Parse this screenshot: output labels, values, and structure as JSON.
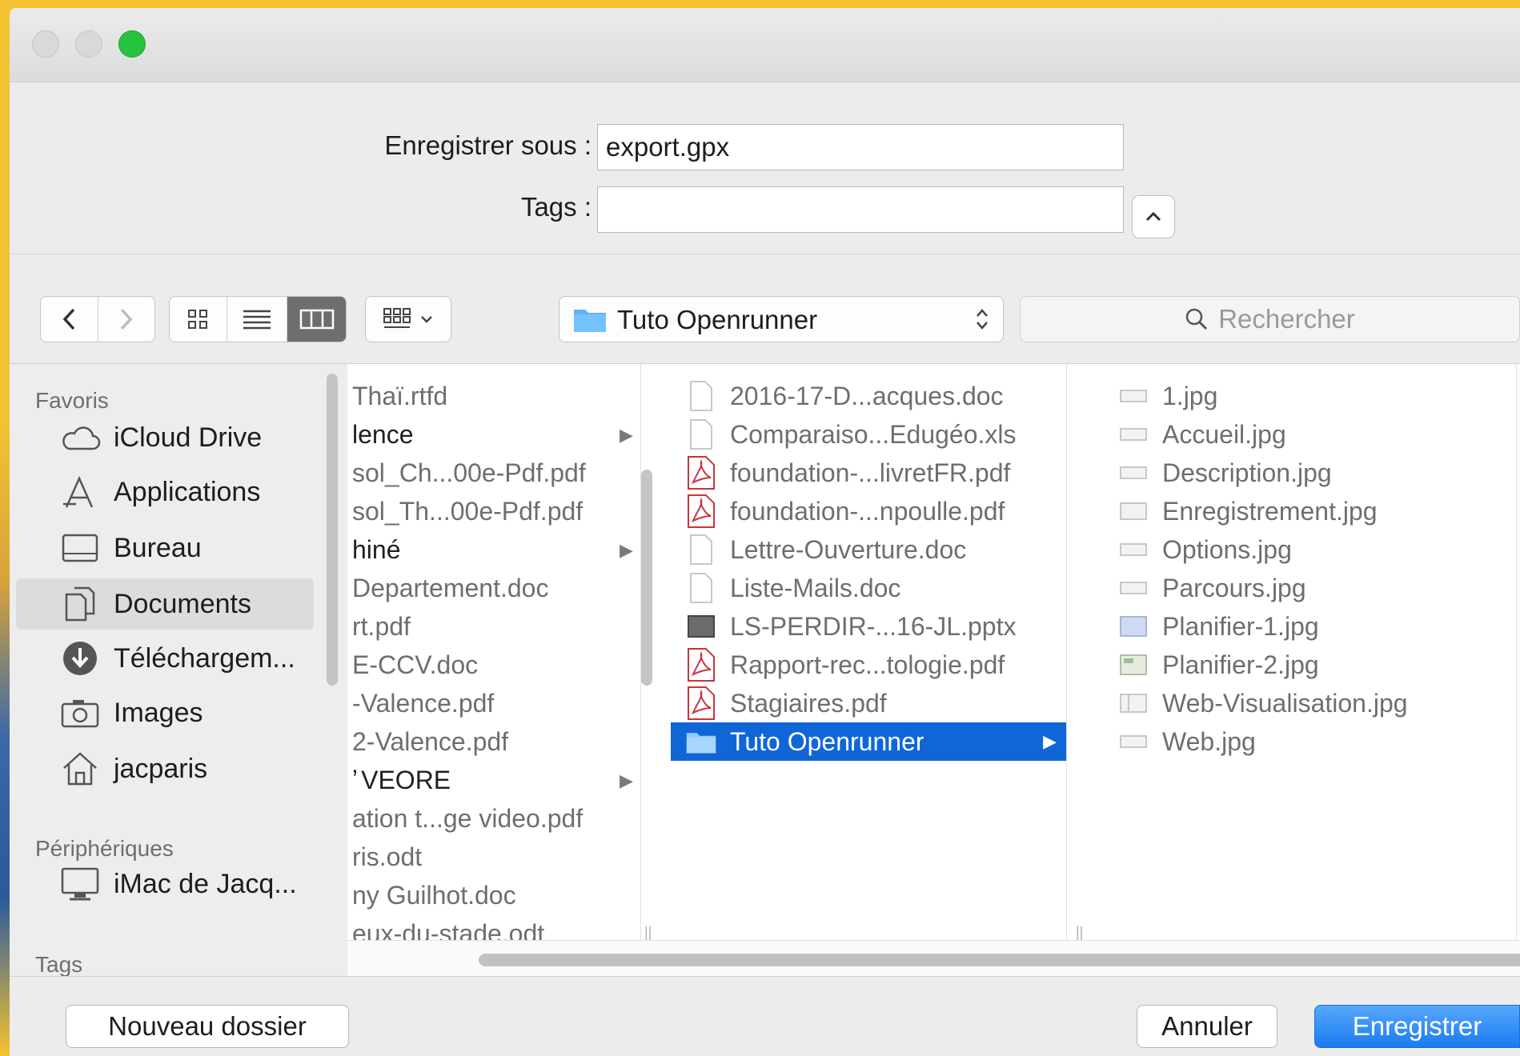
{
  "dialog": {
    "save_as_label": "Enregistrer sous :",
    "save_as_value": "export.gpx",
    "tags_label": "Tags :",
    "tags_value": ""
  },
  "toolbar": {
    "location": "Tuto Openrunner",
    "search_placeholder": "Rechercher",
    "active_view": "columns"
  },
  "sidebar": {
    "favorites_header": "Favoris",
    "favorites": [
      {
        "label": "iCloud Drive",
        "icon": "cloud-icon"
      },
      {
        "label": "Applications",
        "icon": "applications-icon"
      },
      {
        "label": "Bureau",
        "icon": "desktop-icon"
      },
      {
        "label": "Documents",
        "icon": "documents-icon",
        "selected": true
      },
      {
        "label": "Téléchargem...",
        "icon": "download-icon"
      },
      {
        "label": "Images",
        "icon": "camera-icon"
      },
      {
        "label": "jacparis",
        "icon": "home-icon"
      }
    ],
    "devices_header": "Périphériques",
    "devices": [
      {
        "label": "iMac de Jacq...",
        "icon": "computer-icon"
      }
    ],
    "tags_header": "Tags"
  },
  "columns": {
    "col1": [
      {
        "name": "Thaï.rtfd",
        "folder": false
      },
      {
        "name": "lence",
        "folder": true
      },
      {
        "name": "sol_Ch...00e-Pdf.pdf",
        "folder": false
      },
      {
        "name": "sol_Th...00e-Pdf.pdf",
        "folder": false
      },
      {
        "name": "hiné",
        "folder": true
      },
      {
        "name": "Departement.doc",
        "folder": false
      },
      {
        "name": "rt.pdf",
        "folder": false
      },
      {
        "name": "E-CCV.doc",
        "folder": false
      },
      {
        "name": "-Valence.pdf",
        "folder": false
      },
      {
        "name": "2-Valence.pdf",
        "folder": false
      },
      {
        "name": "VEORE",
        "folder": true
      },
      {
        "name": "ation t...ge video.pdf",
        "folder": false
      },
      {
        "name": "ris.odt",
        "folder": false
      },
      {
        "name": "ny Guilhot.doc",
        "folder": false
      },
      {
        "name": "eux-du-stade.odt",
        "folder": false
      }
    ],
    "col2": [
      {
        "name": "2016-17-D...acques.doc",
        "type": "doc"
      },
      {
        "name": "Comparaiso...Edugéo.xls",
        "type": "doc"
      },
      {
        "name": "foundation-...livretFR.pdf",
        "type": "pdf"
      },
      {
        "name": "foundation-...npoulle.pdf",
        "type": "pdf"
      },
      {
        "name": "Lettre-Ouverture.doc",
        "type": "doc"
      },
      {
        "name": "Liste-Mails.doc",
        "type": "doc"
      },
      {
        "name": "LS-PERDIR-...16-JL.pptx",
        "type": "pptx"
      },
      {
        "name": "Rapport-rec...tologie.pdf",
        "type": "pdf"
      },
      {
        "name": "Stagiaires.pdf",
        "type": "pdf"
      },
      {
        "name": "Tuto Openrunner",
        "type": "folder",
        "selected": true
      }
    ],
    "col3": [
      {
        "name": "1.jpg"
      },
      {
        "name": "Accueil.jpg"
      },
      {
        "name": "Description.jpg"
      },
      {
        "name": "Enregistrement.jpg"
      },
      {
        "name": "Options.jpg"
      },
      {
        "name": "Parcours.jpg"
      },
      {
        "name": "Planifier-1.jpg"
      },
      {
        "name": "Planifier-2.jpg"
      },
      {
        "name": "Web-Visualisation.jpg"
      },
      {
        "name": "Web.jpg"
      }
    ]
  },
  "buttons": {
    "new_folder": "Nouveau dossier",
    "cancel": "Annuler",
    "save": "Enregistrer"
  },
  "colors": {
    "selection": "#1066d6",
    "primary_button": "#1a7cf0",
    "frame": "#f5c232"
  }
}
